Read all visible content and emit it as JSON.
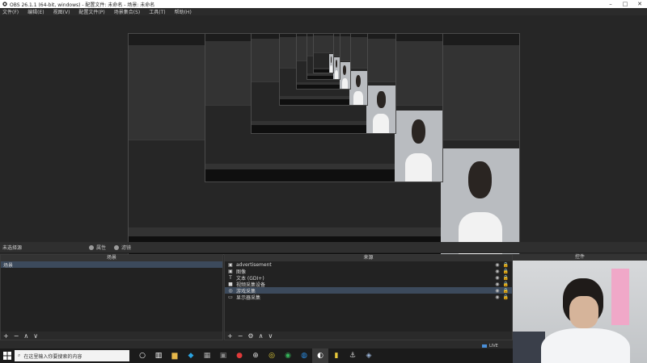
{
  "window": {
    "title": "OBS 26.1.1 (64-bit, windows) - 配置文件: 未命名 - 场景: 未命名"
  },
  "menu": {
    "items": [
      "文件(F)",
      "编辑(E)",
      "视图(V)",
      "配置文件(P)",
      "场景集合(S)",
      "工具(T)",
      "帮助(H)"
    ]
  },
  "scene_info": {
    "current_scene": "未选择源",
    "properties_label": "属性",
    "filters_label": "滤镜"
  },
  "scenes_panel": {
    "header": "场景",
    "items": [
      "场景"
    ]
  },
  "sources_panel": {
    "header": "来源",
    "items": [
      {
        "icon": "image-icon",
        "label": "advertisement"
      },
      {
        "icon": "image-icon",
        "label": "图像"
      },
      {
        "icon": "text-icon",
        "label": "文本 (GDI+)"
      },
      {
        "icon": "camera-icon",
        "label": "视频采集设备"
      },
      {
        "icon": "eye-icon",
        "label": "游戏采集"
      },
      {
        "icon": "monitor-icon",
        "label": "显示器采集"
      }
    ]
  },
  "controls_panel": {
    "header": "控件"
  },
  "status": {
    "fps_text": "LIVE"
  },
  "taskbar": {
    "search_placeholder": "在这里输入你要搜索的内容"
  },
  "colors": {
    "bg": "#2b2b2b",
    "panel": "#222222",
    "selection": "#3c4a5c",
    "accent": "#4a8fd8"
  }
}
